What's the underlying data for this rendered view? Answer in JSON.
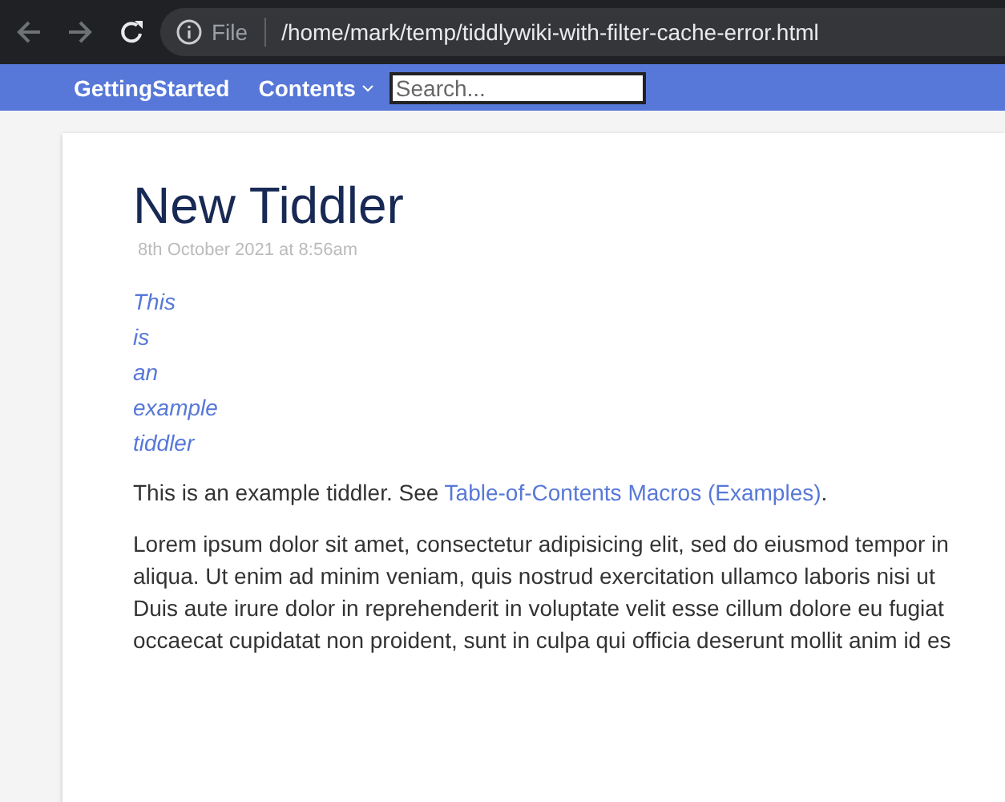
{
  "browser": {
    "security_label": "File",
    "url": "/home/mark/temp/tiddlywiki-with-filter-cache-error.html",
    "back_disabled": true,
    "forward_disabled": true
  },
  "topbar": {
    "items": [
      {
        "label": "GettingStarted",
        "kind": "link"
      },
      {
        "label": "Contents",
        "kind": "dropdown"
      }
    ],
    "search": {
      "placeholder": "Search..."
    }
  },
  "tiddler": {
    "title": "New Tiddler",
    "date": "8th October 2021 at 8:56am",
    "tags": [
      "This",
      "is",
      "an",
      "example",
      "tiddler"
    ],
    "intro": {
      "text": "This is an example tiddler. See ",
      "link": "Table-of-Contents Macros (Examples)",
      "after": "."
    },
    "lorem_lines": [
      "Lorem ipsum dolor sit amet, consectetur adipisicing elit, sed do eiusmod tempor in",
      "aliqua. Ut enim ad minim veniam, quis nostrud exercitation ullamco laboris nisi ut",
      "Duis aute irure dolor in reprehenderit in voluptate velit esse cillum dolore eu fugiat",
      "occaecat cupidatat non proident, sunt in culpa qui officia deserunt mollit anim id es"
    ]
  }
}
